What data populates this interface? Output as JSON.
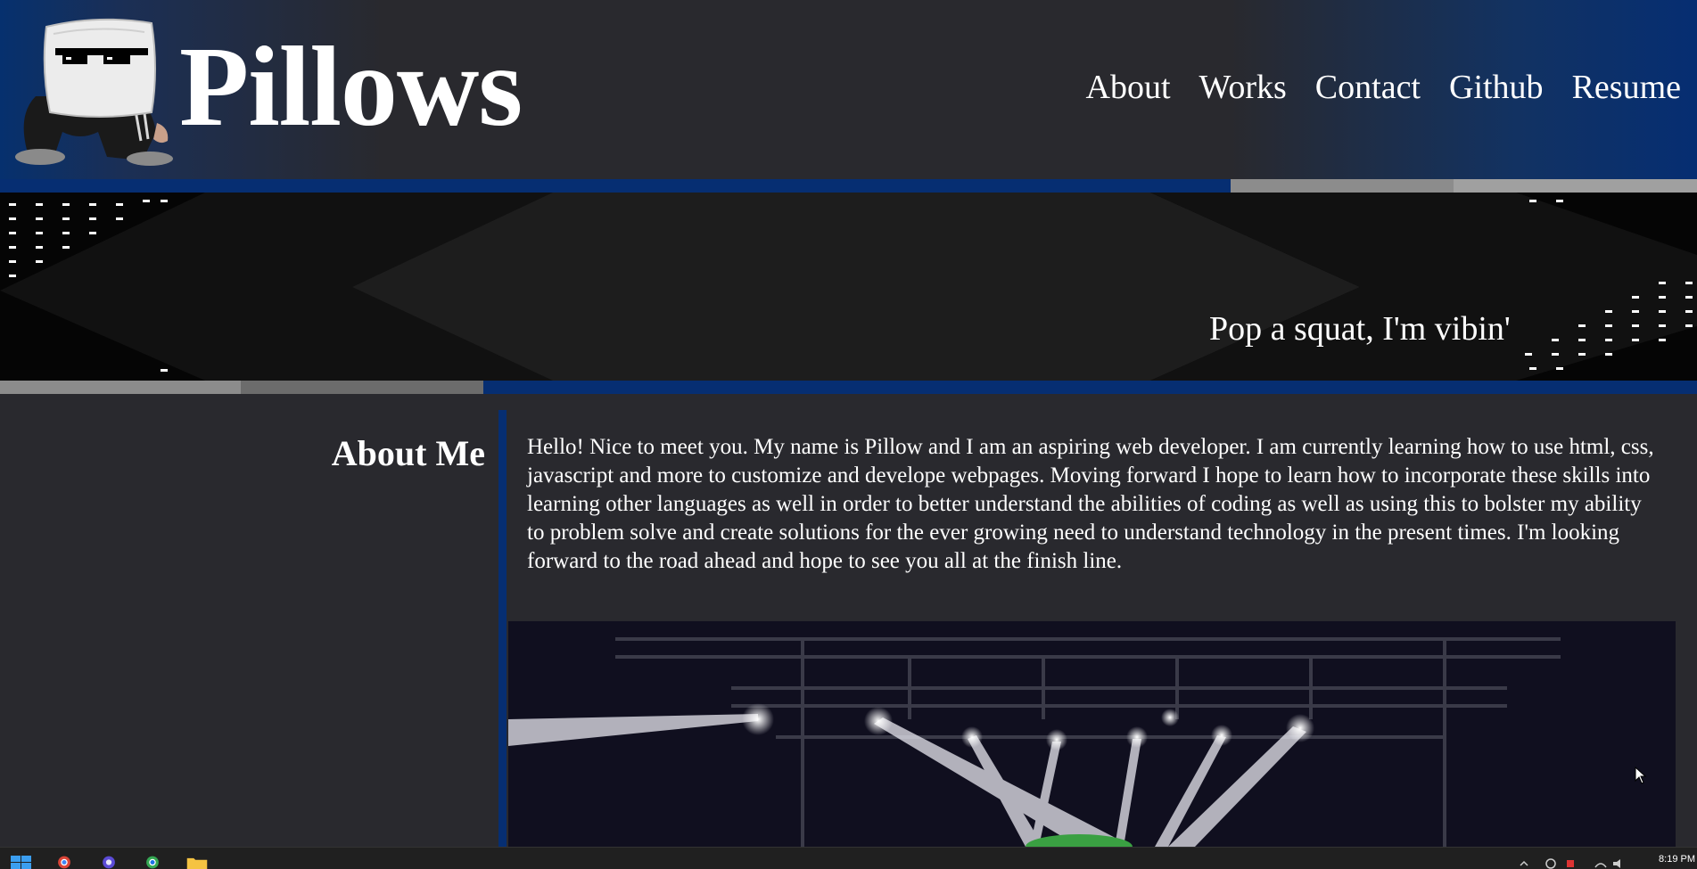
{
  "site": {
    "title": "Pillows"
  },
  "nav": {
    "items": [
      {
        "label": "About"
      },
      {
        "label": "Works"
      },
      {
        "label": "Contact"
      },
      {
        "label": "Github"
      },
      {
        "label": "Resume"
      }
    ]
  },
  "hero": {
    "tagline": "Pop a squat, I'm vibin'"
  },
  "about": {
    "heading": "About Me",
    "body": "Hello! Nice to meet you. My name is Pillow and I am an aspiring web developer. I am currently learning how to use html, css, javascript and more to customize and develope webpages. Moving forward I hope to learn how to incorporate these skills into learning other languages as well in order to better understand the abilities of coding as well as using this to bolster my ability to problem solve and create solutions for the ever growing need to understand technology in the present times. I'm looking forward to the road ahead and hope to see you all at the finish line."
  },
  "taskbar": {
    "clock": "8:19 PM",
    "apps": [
      "windows-start-icon",
      "chrome-icon",
      "firefox-icon",
      "chrome-canary-icon",
      "file-explorer-icon"
    ]
  },
  "colors": {
    "brand_blue": "#062e72",
    "page_bg": "#29292e",
    "hero_bg": "#050505"
  }
}
